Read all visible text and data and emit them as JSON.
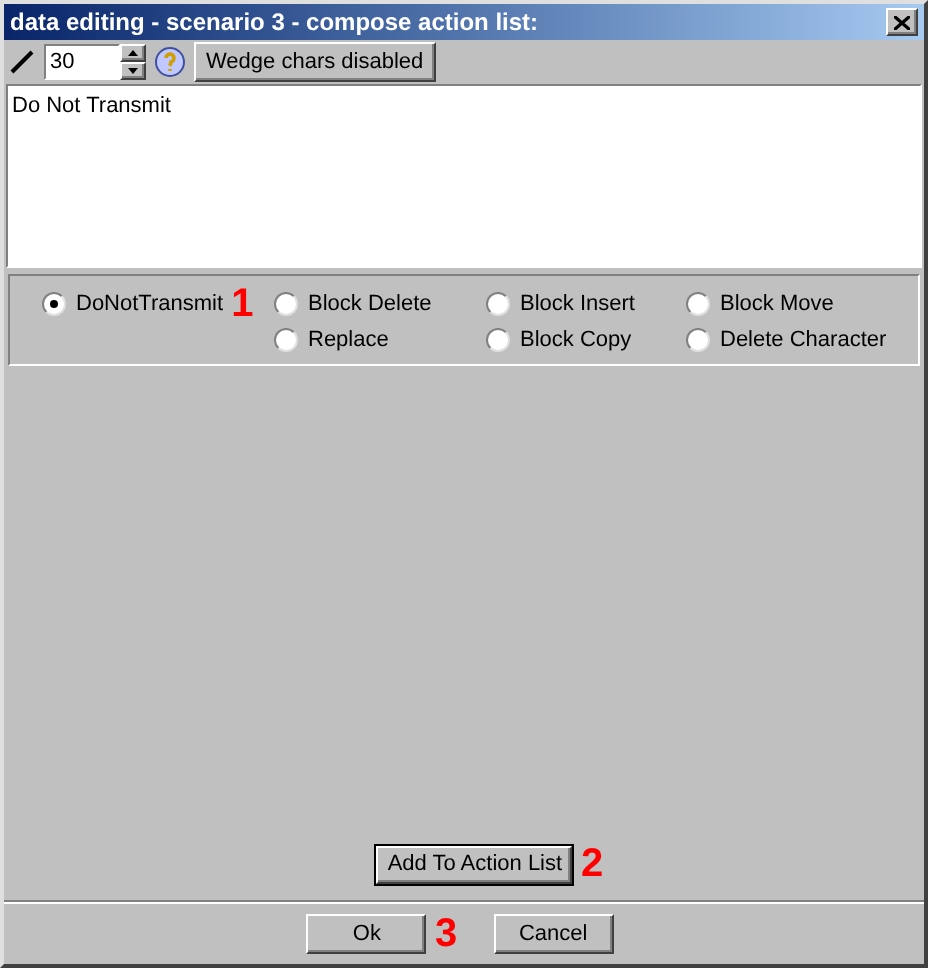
{
  "window": {
    "title": "data editing - scenario 3 - compose action list:"
  },
  "toolbar": {
    "width_value": "30",
    "wedge_button": "Wedge chars disabled"
  },
  "text_area": {
    "value": "Do Not Transmit"
  },
  "actions": {
    "columns": [
      [
        {
          "label": "DoNotTransmit",
          "selected": true,
          "annotation": "1"
        }
      ],
      [
        {
          "label": "Block Delete",
          "selected": false
        },
        {
          "label": "Replace",
          "selected": false
        }
      ],
      [
        {
          "label": "Block Insert",
          "selected": false
        },
        {
          "label": "Block Copy",
          "selected": false
        }
      ],
      [
        {
          "label": "Block Move",
          "selected": false
        },
        {
          "label": "Delete Character",
          "selected": false
        }
      ]
    ]
  },
  "add_button": {
    "label": "Add To Action List",
    "annotation": "2"
  },
  "buttons": [
    {
      "label": "Ok",
      "annotation": "3"
    },
    {
      "label": "Cancel"
    }
  ]
}
